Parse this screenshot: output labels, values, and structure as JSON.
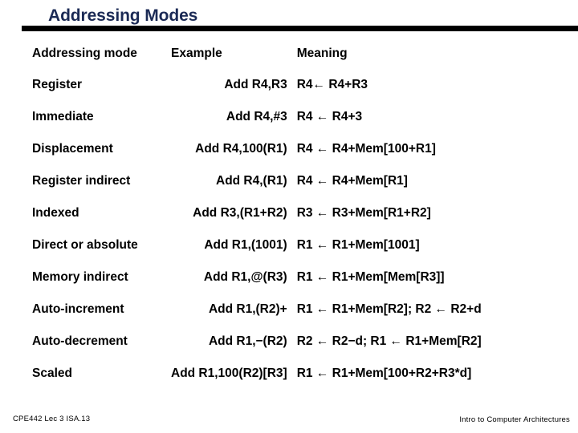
{
  "slide": {
    "title": "Addressing Modes",
    "title_color": "#1b2a55",
    "rule_color": "#000000"
  },
  "table": {
    "headers": {
      "mode": "Addressing mode",
      "example": "Example",
      "meaning": "Meaning"
    },
    "rows": [
      {
        "mode": "Register",
        "example": "Add R4,R3",
        "meaning": "R4← R4+R3"
      },
      {
        "mode": "Immediate",
        "example": "Add R4,#3",
        "meaning": "R4 ← R4+3"
      },
      {
        "mode": "Displacement",
        "example": "Add R4,100(R1)",
        "meaning": "R4 ← R4+Mem[100+R1]"
      },
      {
        "mode": "Register indirect",
        "example": "Add R4,(R1)",
        "meaning": "R4 ← R4+Mem[R1]"
      },
      {
        "mode": "Indexed",
        "example": "Add R3,(R1+R2)",
        "meaning": "R3 ← R3+Mem[R1+R2]"
      },
      {
        "mode": "Direct or absolute",
        "example": "Add R1,(1001)",
        "meaning": "R1 ← R1+Mem[1001]"
      },
      {
        "mode": "Memory indirect",
        "example": "Add R1,@(R3)",
        "meaning": "R1 ← R1+Mem[Mem[R3]]"
      },
      {
        "mode": "Auto-increment",
        "example": "Add R1,(R2)+",
        "meaning": "R1 ← R1+Mem[R2]; R2 ← R2+d"
      },
      {
        "mode": "Auto-decrement",
        "example": "Add R1,−(R2)",
        "meaning": "R2 ← R2−d; R1 ← R1+Mem[R2]"
      },
      {
        "mode": "Scaled",
        "example": "Add R1,100(R2)[R3]",
        "meaning": "R1 ← R1+Mem[100+R2+R3*d]"
      }
    ]
  },
  "footer": {
    "left": "CPE442  Lec 3 ISA.13",
    "right": "Intro to Computer Architectures"
  }
}
